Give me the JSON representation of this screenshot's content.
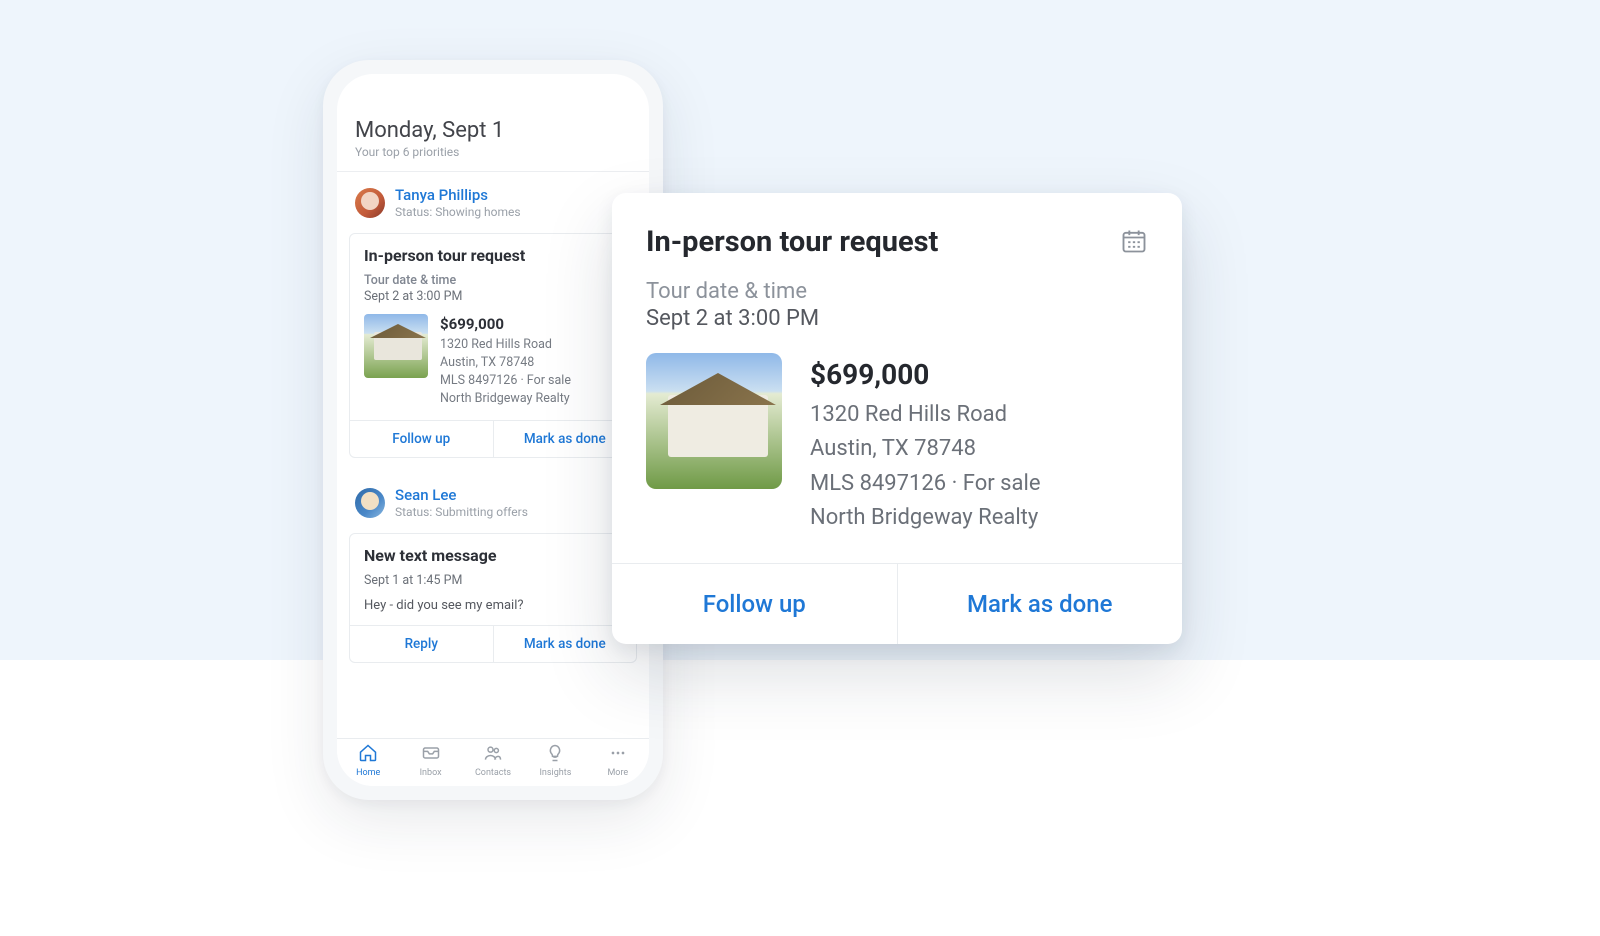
{
  "header": {
    "date": "Monday, Sept 1",
    "subtitle": "Your top 6 priorities"
  },
  "contacts": [
    {
      "name": "Tanya Phillips",
      "status": "Status: Showing homes",
      "card": {
        "title": "In-person tour request",
        "meta_label": "Tour date & time",
        "meta_value": "Sept 2 at 3:00 PM",
        "price": "$699,000",
        "line1": "1320 Red Hills Road",
        "line2": "Austin, TX 78748",
        "line3": "MLS 8497126  ·  For sale",
        "line4": "North Bridgeway Realty",
        "action_primary": "Follow up",
        "action_secondary": "Mark as done"
      }
    },
    {
      "name": "Sean Lee",
      "status": "Status: Submitting offers",
      "card": {
        "title": "New text message",
        "meta_value": "Sept 1 at 1:45 PM",
        "body": "Hey - did you see my email?",
        "action_primary": "Reply",
        "action_secondary": "Mark as done"
      }
    }
  ],
  "nav": {
    "home": "Home",
    "inbox": "Inbox",
    "contacts": "Contacts",
    "insights": "Insights",
    "more": "More"
  },
  "popup": {
    "title": "In-person tour request",
    "meta_label": "Tour date & time",
    "meta_value": "Sept 2 at 3:00 PM",
    "price": "$699,000",
    "line1": "1320 Red Hills Road",
    "line2": "Austin, TX 78748",
    "line3": "MLS 8497126  ·  For sale",
    "line4": "North Bridgeway Realty",
    "action_primary": "Follow up",
    "action_secondary": "Mark as done"
  }
}
